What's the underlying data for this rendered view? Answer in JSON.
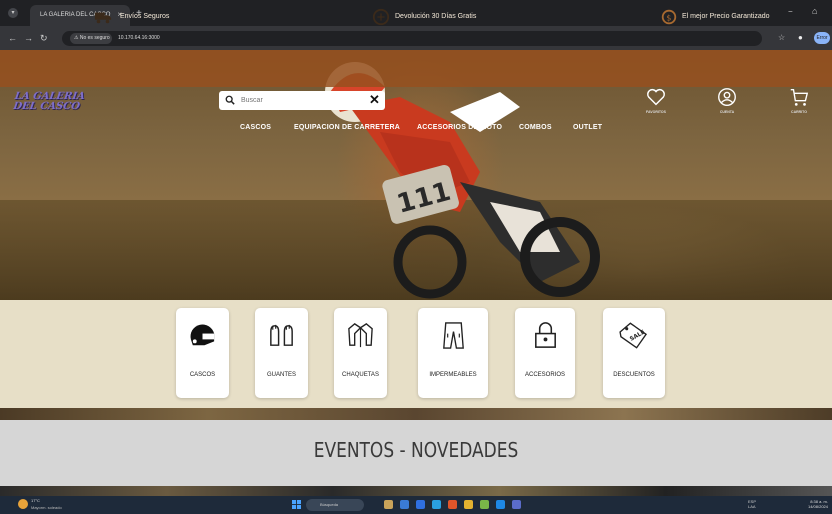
{
  "browser": {
    "tab_title": "LA GALERIA DEL CASCO",
    "tab_close": "×",
    "new_tab": "+",
    "window_minimize": "−",
    "window_restore": "⌂",
    "security_chip": "⚠ No es seguro",
    "url": "10.170.64.16:3000",
    "profile_button": "Error"
  },
  "promo_bar": {
    "items": [
      {
        "label": "Envíos Seguros",
        "icon": "truck-icon"
      },
      {
        "label": "Devolución 30 Días Gratis",
        "icon": "return-icon"
      },
      {
        "label": "El mejor Precio Garantizado",
        "icon": "price-tag-icon"
      }
    ]
  },
  "header": {
    "logo_line1": "LA GALERIA",
    "logo_line2": "DEL CASCO",
    "search_placeholder": "Buscar",
    "search_clear": "✕",
    "nav": [
      "CASCOS",
      "EQUIPACION DE CARRETERA",
      "ACCESORIOS DE MOTO",
      "COMBOS",
      "OUTLET"
    ],
    "icons": [
      {
        "name": "favorites-icon",
        "label": "FAVORITOS"
      },
      {
        "name": "account-icon",
        "label": "CUENTA"
      },
      {
        "name": "cart-icon",
        "label": "CARRITO"
      }
    ]
  },
  "categories": [
    {
      "label": "CASCOS",
      "icon": "helmet-icon"
    },
    {
      "label": "GUANTES",
      "icon": "gloves-icon"
    },
    {
      "label": "CHAQUETAS",
      "icon": "jacket-icon"
    },
    {
      "label": "IMPERMEABLES",
      "icon": "rain-pants-icon"
    },
    {
      "label": "ACCESORIOS",
      "icon": "lock-icon"
    },
    {
      "label": "DESCUENTOS",
      "icon": "sale-tag-icon"
    }
  ],
  "events": {
    "title": "EVENTOS - NOVEDADES"
  },
  "taskbar": {
    "weather_temp": "17°C",
    "weather_desc": "Mayorm. soleado",
    "search_label": "Búsqueda",
    "tray_lang_1": "ESP",
    "tray_lang_2": "LAA",
    "time": "8:38 a. m.",
    "date": "14/08/2024"
  },
  "colors": {
    "promo_bar": "#96501e",
    "logo": "#7e6ec9",
    "category_band": "#e7dfc7",
    "events_bg": "#d6d6d6",
    "taskbar": "#1e2a3a"
  }
}
